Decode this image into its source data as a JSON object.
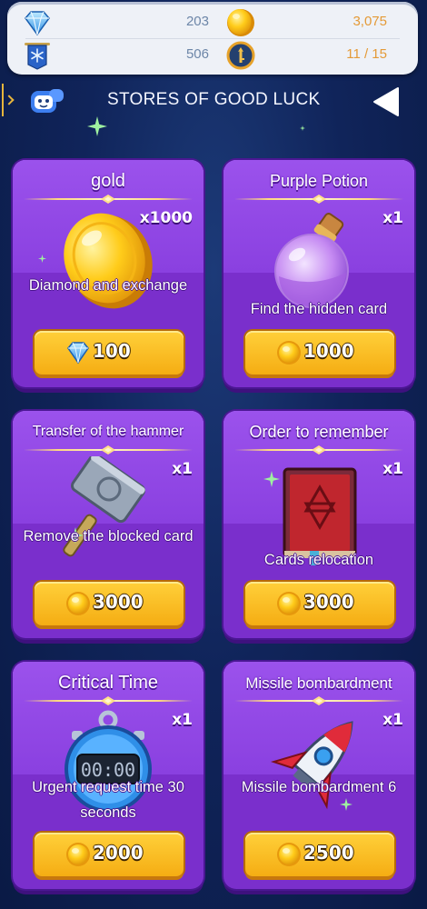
{
  "resources": {
    "diamonds": {
      "icon": "diamond-icon",
      "value": "203"
    },
    "gold": {
      "icon": "gold-coin-icon",
      "value": "3,075"
    },
    "banner": {
      "icon": "snowflake-banner-icon",
      "value": "506"
    },
    "keys": {
      "icon": "key-shield-icon",
      "value": "11 / 15"
    }
  },
  "header": {
    "title": "STORES OF GOOD LUCK",
    "mascot_icon": "robot-mascot-icon",
    "back_icon": "back-arrow-icon"
  },
  "items": [
    {
      "title": "gold",
      "quantity": "x1000",
      "description": "Diamond and exchange",
      "currency": "diamond",
      "price": "100"
    },
    {
      "title": "Purple Potion",
      "quantity": "x1",
      "description": "Find the hidden card",
      "currency": "gold",
      "price": "1000"
    },
    {
      "title": "Transfer of the hammer",
      "quantity": "x1",
      "description": "Remove the blocked card",
      "currency": "gold",
      "price": "3000"
    },
    {
      "title": "Order to remember",
      "quantity": "x1",
      "description": "Cards relocation",
      "currency": "gold",
      "price": "3000"
    },
    {
      "title": "Critical Time",
      "quantity": "x1",
      "description": "Urgent request time 30 seconds",
      "currency": "gold",
      "price": "2000"
    },
    {
      "title": "Missile bombardment",
      "quantity": "x1",
      "description": "Missile bombardment 6",
      "currency": "gold",
      "price": "2500"
    }
  ],
  "colors": {
    "background": "#10245a",
    "card": "#7a2fcc",
    "button": "#f5ad13",
    "accent_blue": "#6d86a8",
    "accent_orange": "#e49a37"
  }
}
